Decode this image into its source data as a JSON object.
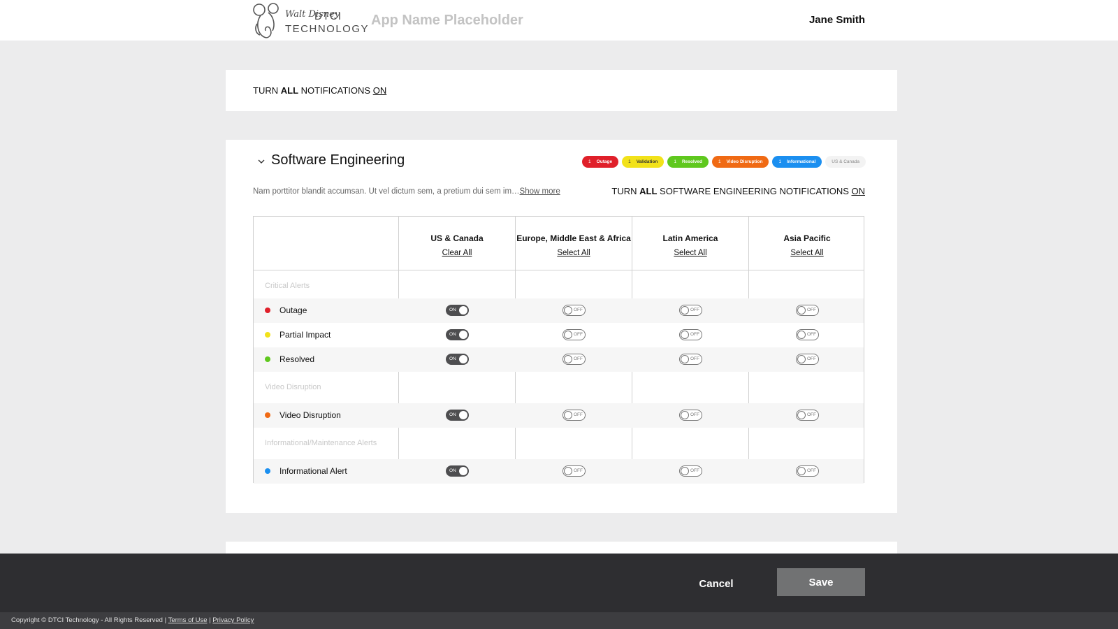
{
  "header": {
    "logo_brand": "Walt Disney",
    "logo_dtci": "DTCI",
    "logo_tech": "TECHNOLOGY",
    "app_name": "App Name Placeholder",
    "user_name": "Jane Smith"
  },
  "global_toggle": {
    "prefix": "TURN",
    "all": "ALL",
    "middle": "NOTIFICATIONS",
    "state": "ON"
  },
  "section": {
    "title": "Software Engineering",
    "badges": [
      {
        "count": "1",
        "label": "Outage",
        "color": "#e0202a"
      },
      {
        "count": "1",
        "label": "Validation",
        "color": "#f2e21a",
        "text_color": "#333"
      },
      {
        "count": "1",
        "label": "Resolved",
        "color": "#5fc81e"
      },
      {
        "count": "1",
        "label": "Video Disruption",
        "color": "#f06a14"
      },
      {
        "count": "1",
        "label": "Informational",
        "color": "#1b8ff0"
      }
    ],
    "region_chip": "US & Canada",
    "description": "Nam porttitor blandit accumsan. Ut vel dictum sem, a pretium dui sem im…",
    "show_more": "Show more",
    "toggle_line": {
      "prefix": "TURN",
      "all": "ALL",
      "middle": "SOFTWARE ENGINEERING NOTIFICATIONS",
      "state": "ON"
    }
  },
  "table": {
    "columns": [
      {
        "name": "US & Canada",
        "action": "Clear All"
      },
      {
        "name": "Europe, Middle East & Africa",
        "action": "Select All"
      },
      {
        "name": "Latin America",
        "action": "Select All"
      },
      {
        "name": "Asia Pacific",
        "action": "Select All"
      }
    ],
    "groups": [
      {
        "label": "Critical Alerts",
        "rows": [
          {
            "label": "Outage",
            "dot": "#e0202a",
            "states": [
              "ON",
              "OFF",
              "OFF",
              "OFF"
            ]
          },
          {
            "label": "Partial Impact",
            "dot": "#f2e21a",
            "states": [
              "ON",
              "OFF",
              "OFF",
              "OFF"
            ]
          },
          {
            "label": "Resolved",
            "dot": "#5fc81e",
            "states": [
              "ON",
              "OFF",
              "OFF",
              "OFF"
            ]
          }
        ]
      },
      {
        "label": "Video Disruption",
        "rows": [
          {
            "label": "Video Disruption",
            "dot": "#f06a14",
            "states": [
              "ON",
              "OFF",
              "OFF",
              "OFF"
            ]
          }
        ]
      },
      {
        "label": "Informational/Maintenance Alerts",
        "rows": [
          {
            "label": "Informational Alert",
            "dot": "#1b8ff0",
            "states": [
              "ON",
              "OFF",
              "OFF",
              "OFF"
            ]
          }
        ]
      }
    ]
  },
  "actions": {
    "cancel": "Cancel",
    "save": "Save"
  },
  "footer": {
    "copyright": "Copyright © DTCI Technology - All Rights Reserved",
    "separator": "|",
    "terms": "Terms of Use",
    "privacy": "Privacy Policy"
  }
}
